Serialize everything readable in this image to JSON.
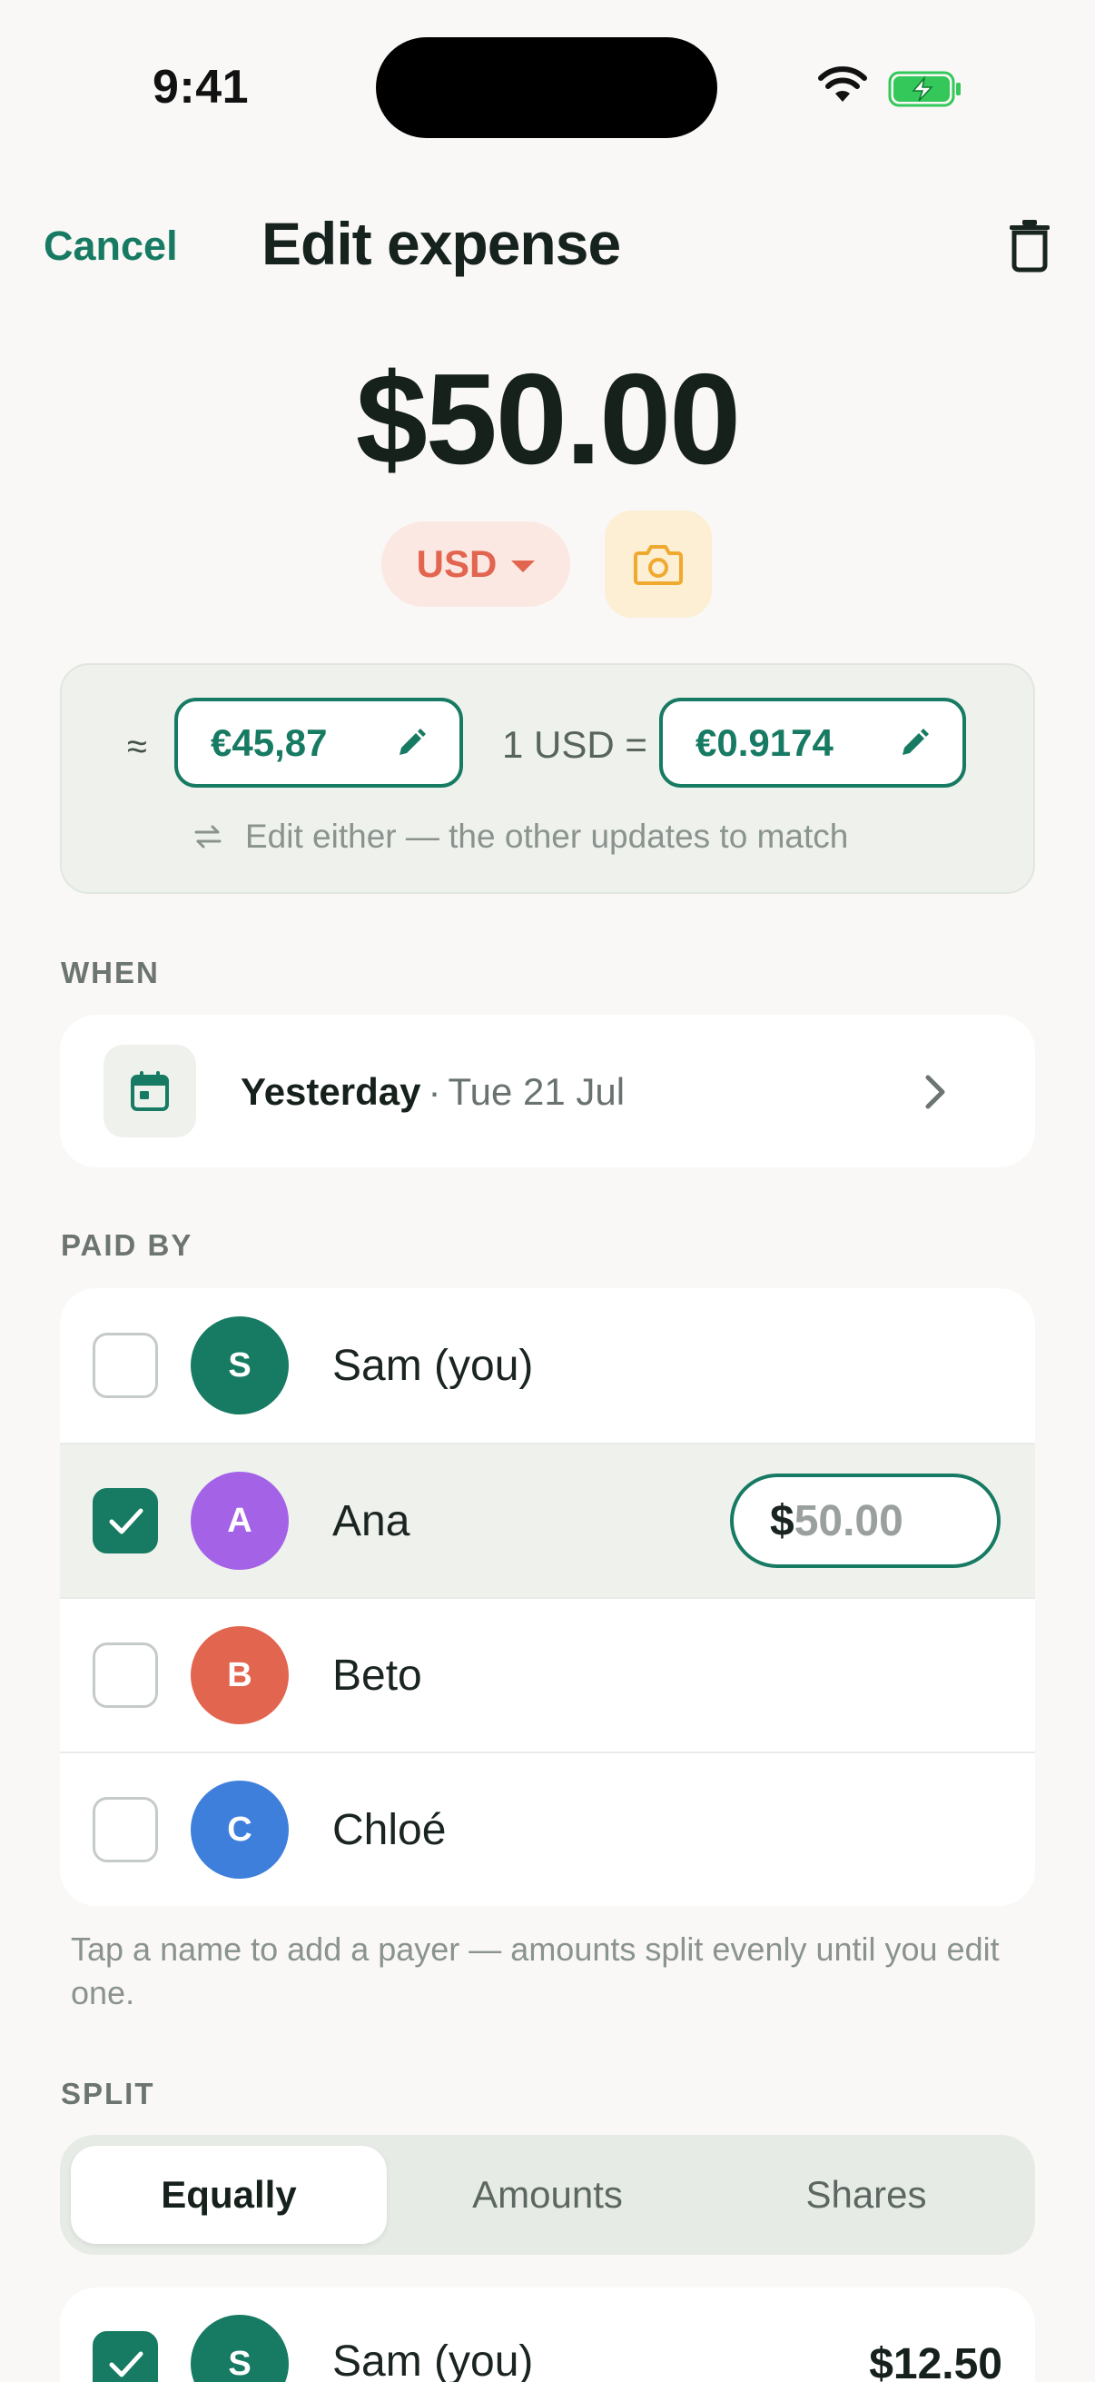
{
  "status": {
    "time": "9:41"
  },
  "header": {
    "cancel_label": "Cancel",
    "title": "Edit expense"
  },
  "expense": {
    "amount": "$50.00",
    "currency": "USD"
  },
  "conversion": {
    "approx_symbol": "≈",
    "converted_amount": "€45,87",
    "rate_label": "1 USD =",
    "rate_value": "€0.9174",
    "hint": "Edit either — the other updates to match"
  },
  "when": {
    "section_label": "WHEN",
    "main": "Yesterday",
    "separator": "·",
    "sub": "Tue 21 Jul"
  },
  "paid_by": {
    "section_label": "PAID BY",
    "people": [
      {
        "initial": "S",
        "name": "Sam (you)",
        "color": "#177a62",
        "checked": false
      },
      {
        "initial": "A",
        "name": "Ana",
        "color": "#a463e6",
        "checked": true
      },
      {
        "initial": "B",
        "name": "Beto",
        "color": "#e2654f",
        "checked": false
      },
      {
        "initial": "C",
        "name": "Chloé",
        "color": "#3f7fdc",
        "checked": false
      }
    ],
    "payer_amount_currency": "$",
    "payer_amount_value": "50.00",
    "hint": "Tap a name to add a payer — amounts split evenly until you edit one."
  },
  "split": {
    "section_label": "SPLIT",
    "modes": [
      "Equally",
      "Amounts",
      "Shares"
    ],
    "active_mode": "Equally",
    "rows": [
      {
        "initial": "S",
        "name": "Sam (you)",
        "amount": "$12.50",
        "color": "#177a62",
        "checked": true
      }
    ]
  },
  "colors": {
    "accent": "#177a62",
    "danger": "#e2654f",
    "background": "#f9f8f6"
  }
}
